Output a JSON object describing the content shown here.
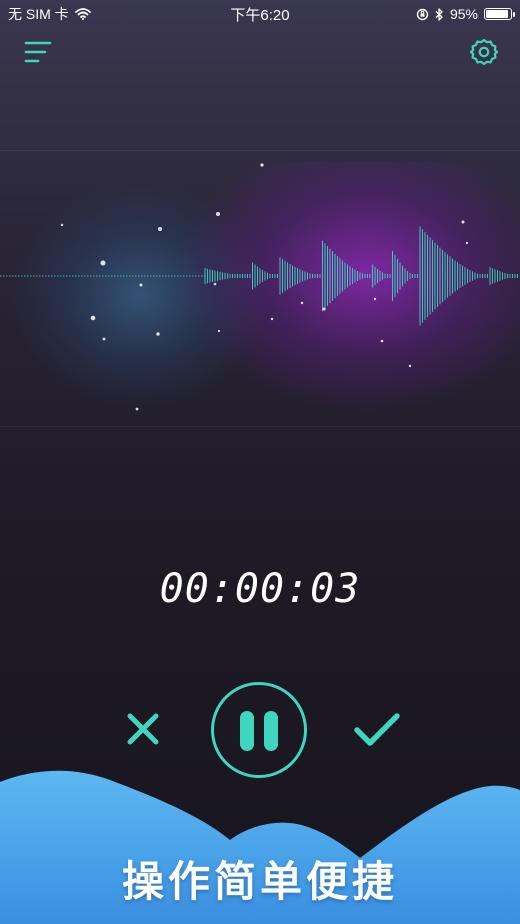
{
  "status_bar": {
    "carrier": "无 SIM 卡",
    "time": "下午6:20",
    "battery_percent": "95%",
    "battery_level": 0.95,
    "icons": [
      "wifi-icon",
      "orientation-lock-icon",
      "bluetooth-icon",
      "battery-icon"
    ]
  },
  "header": {
    "menu_icon": "menu-icon",
    "settings_icon": "gear-icon"
  },
  "recorder": {
    "elapsed_time": "00:00:03",
    "cancel_icon": "close-icon",
    "pause_icon": "pause-icon",
    "confirm_icon": "checkmark-icon"
  },
  "promo": {
    "caption": "操作简单便捷"
  },
  "colors": {
    "accent": "#3fd6c0",
    "cloud": "#5cb8f2",
    "background_top": "#3a3750",
    "background_bottom": "#17151d",
    "glow_purple": "#8c28b4",
    "glow_blue": "#3c78aa"
  }
}
